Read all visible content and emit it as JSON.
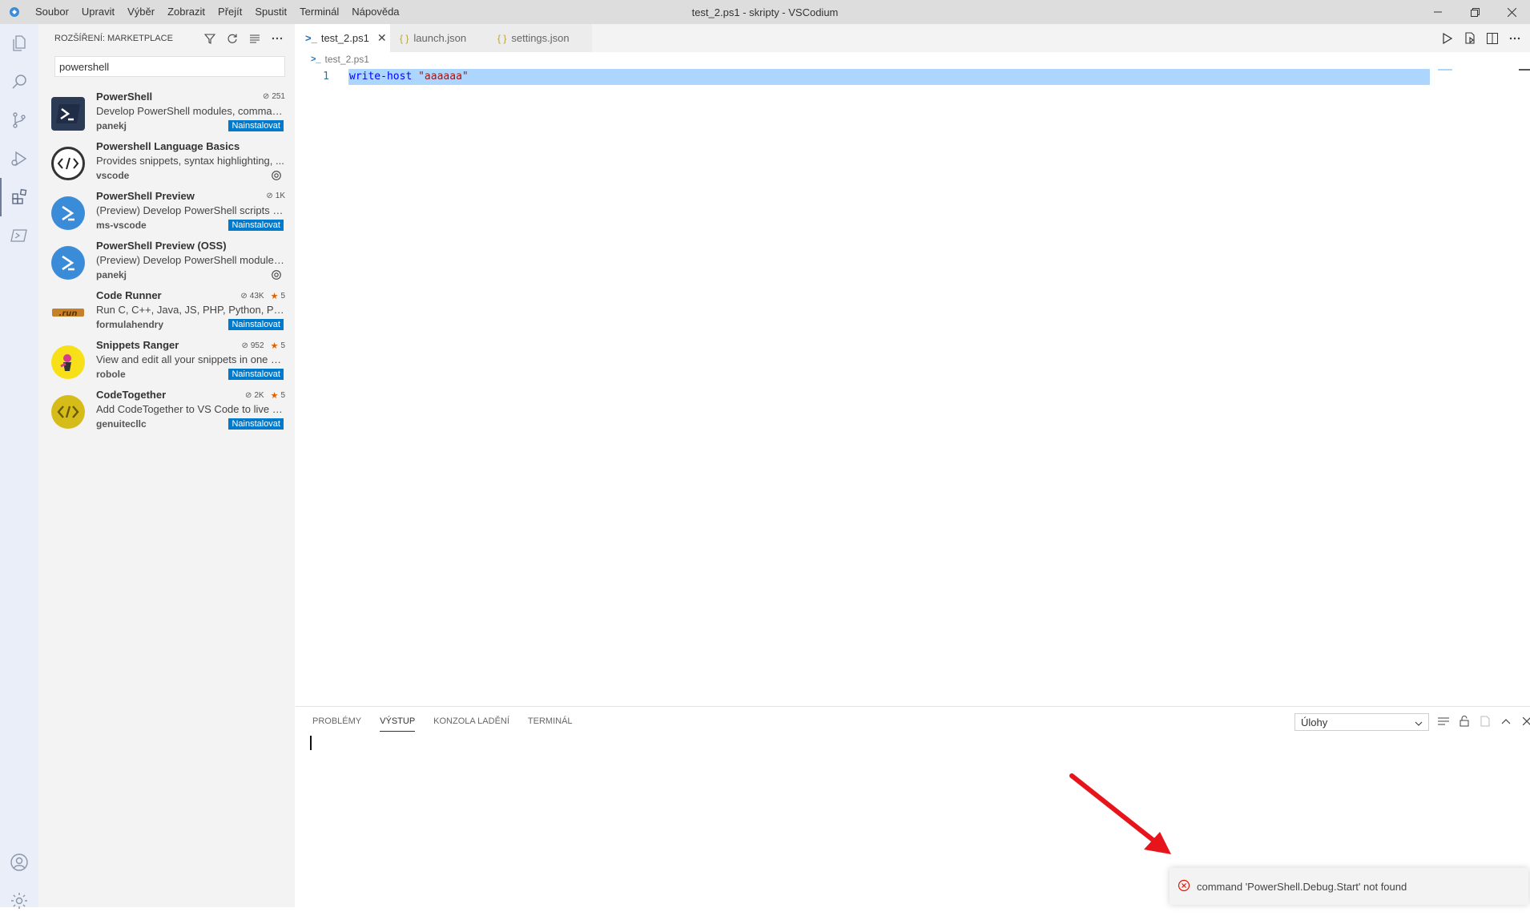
{
  "window": {
    "title": "test_2.ps1 - skripty - VSCodium"
  },
  "menu": [
    "Soubor",
    "Upravit",
    "Výběr",
    "Zobrazit",
    "Přejít",
    "Spustit",
    "Terminál",
    "Nápověda"
  ],
  "activity_bar": [
    "files-icon",
    "search-icon",
    "source-control-icon",
    "run-debug-icon",
    "extensions-icon",
    "powershell-icon",
    "account-icon",
    "manage-gear-icon"
  ],
  "sidebar": {
    "title": "ROZŠÍŘENÍ: MARKETPLACE",
    "search_value": "powershell",
    "extensions": [
      {
        "name": "PowerShell",
        "desc": "Develop PowerShell modules, comman...",
        "publisher": "panekj",
        "downloads": "251",
        "rating": "",
        "action": "Nainstalovat",
        "icon": "powershell-dark-icon"
      },
      {
        "name": "Powershell Language Basics",
        "desc": "Provides snippets, syntax highlighting, ...",
        "publisher": "vscode",
        "downloads": "",
        "rating": "",
        "action": "",
        "icon": "code-brackets-icon"
      },
      {
        "name": "PowerShell Preview",
        "desc": "(Preview) Develop PowerShell scripts in ...",
        "publisher": "ms-vscode",
        "downloads": "1K",
        "rating": "",
        "action": "Nainstalovat",
        "icon": "powershell-blue-icon"
      },
      {
        "name": "PowerShell Preview (OSS)",
        "desc": "(Preview) Develop PowerShell modules,...",
        "publisher": "panekj",
        "downloads": "",
        "rating": "",
        "action": "",
        "icon": "powershell-blue-icon"
      },
      {
        "name": "Code Runner",
        "desc": "Run C, C++, Java, JS, PHP, Python, Perl, ...",
        "publisher": "formulahendry",
        "downloads": "43K",
        "rating": "5",
        "action": "Nainstalovat",
        "icon": "code-runner-logo"
      },
      {
        "name": "Snippets Ranger",
        "desc": "View and edit all your snippets in one p...",
        "publisher": "robole",
        "downloads": "952",
        "rating": "5",
        "action": "Nainstalovat",
        "icon": "snippets-ranger-logo"
      },
      {
        "name": "CodeTogether",
        "desc": "Add CodeTogether to VS Code to live s...",
        "publisher": "genuitecllc",
        "downloads": "2K",
        "rating": "5",
        "action": "Nainstalovat",
        "icon": "codetogether-logo"
      }
    ]
  },
  "tabs": [
    {
      "label": "test_2.ps1",
      "active": true
    },
    {
      "label": "launch.json",
      "active": false
    },
    {
      "label": "settings.json",
      "active": false
    }
  ],
  "breadcrumb": "test_2.ps1",
  "editor": {
    "line_number": "1",
    "code_keyword": "write-host",
    "code_string": "\"aaaaaa\""
  },
  "panel": {
    "tabs": [
      "PROBLÉMY",
      "VÝSTUP",
      "KONZOLA LADĚNÍ",
      "TERMINÁL"
    ],
    "active_tab": "VÝSTUP",
    "output_channel": "Úlohy"
  },
  "notification": {
    "message": "command 'PowerShell.Debug.Start' not found",
    "level": "error"
  },
  "colors": {
    "accent": "#007acc",
    "selection": "#add6ff",
    "arrow": "#e8141c",
    "star": "#df6100"
  }
}
